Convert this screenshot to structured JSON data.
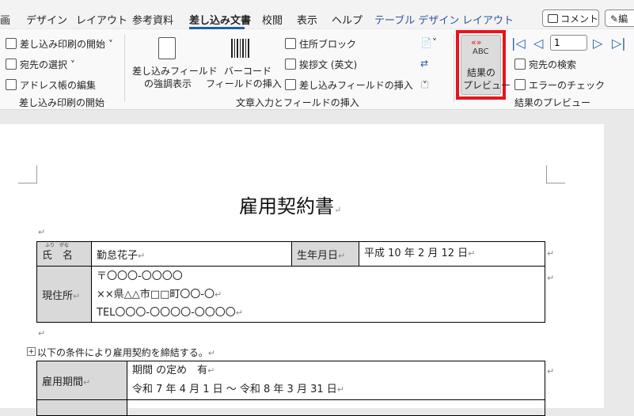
{
  "tabs": [
    "画",
    "デザイン",
    "レイアウト",
    "参考資料",
    "差し込み文書",
    "校閲",
    "表示",
    "ヘルプ",
    "テーブル デザイン",
    "レイアウト"
  ],
  "top_buttons": {
    "comment": "コメント",
    "edit": "編"
  },
  "ribbon": {
    "start_group": {
      "start_mail_merge": "差し込み印刷の開始 ˅",
      "select_recipients": "宛先の選択 ˅",
      "edit_address_book": "アドレス帳の編集",
      "label": "差し込み印刷の開始"
    },
    "write_group": {
      "highlight_fields": [
        "差し込みフィールド",
        "の強調表示"
      ],
      "barcode_field": [
        "バーコード",
        "フィールドの挿入 ˅"
      ],
      "address_block": "住所ブロック",
      "greeting_line": "挨拶文 (英文)",
      "insert_merge_field": "差し込みフィールドの挿入",
      "label": "文章入力とフィールドの挿入"
    },
    "preview_group": {
      "preview_icon_text": "ABC",
      "preview_icon_arrows": "«»",
      "preview_results": [
        "結果の",
        "プレビュー"
      ],
      "record_number": "1",
      "find_recipient": "宛先の検索",
      "check_errors": "エラーのチェック",
      "label": "結果のプレビュー"
    },
    "highlight_color": "#e8141b"
  },
  "document": {
    "title": "雇用契約書",
    "table1": {
      "name_label": "氏　名",
      "name_ruby": "ふり　がな",
      "name_value": "勤怠花子",
      "dob_label": "生年月日",
      "dob_value": "平成 10 年 2 月 12 日",
      "address_label": "現住所",
      "postal": "〒〇〇〇-〇〇〇〇",
      "address_line": "××県△△市□□町〇〇-〇",
      "tel": "TEL〇〇〇-〇〇〇〇-〇〇〇〇"
    },
    "intro": "以下の条件により雇用契約を締結する。",
    "table2": {
      "period_label": "雇用期間",
      "period_line1": "期間 の定め　有",
      "period_line2": "令和 7 年 4 月 1 日 ～ 令和 8 年 3 月 31 日"
    }
  },
  "marks": {
    "paragraph": "↵"
  }
}
